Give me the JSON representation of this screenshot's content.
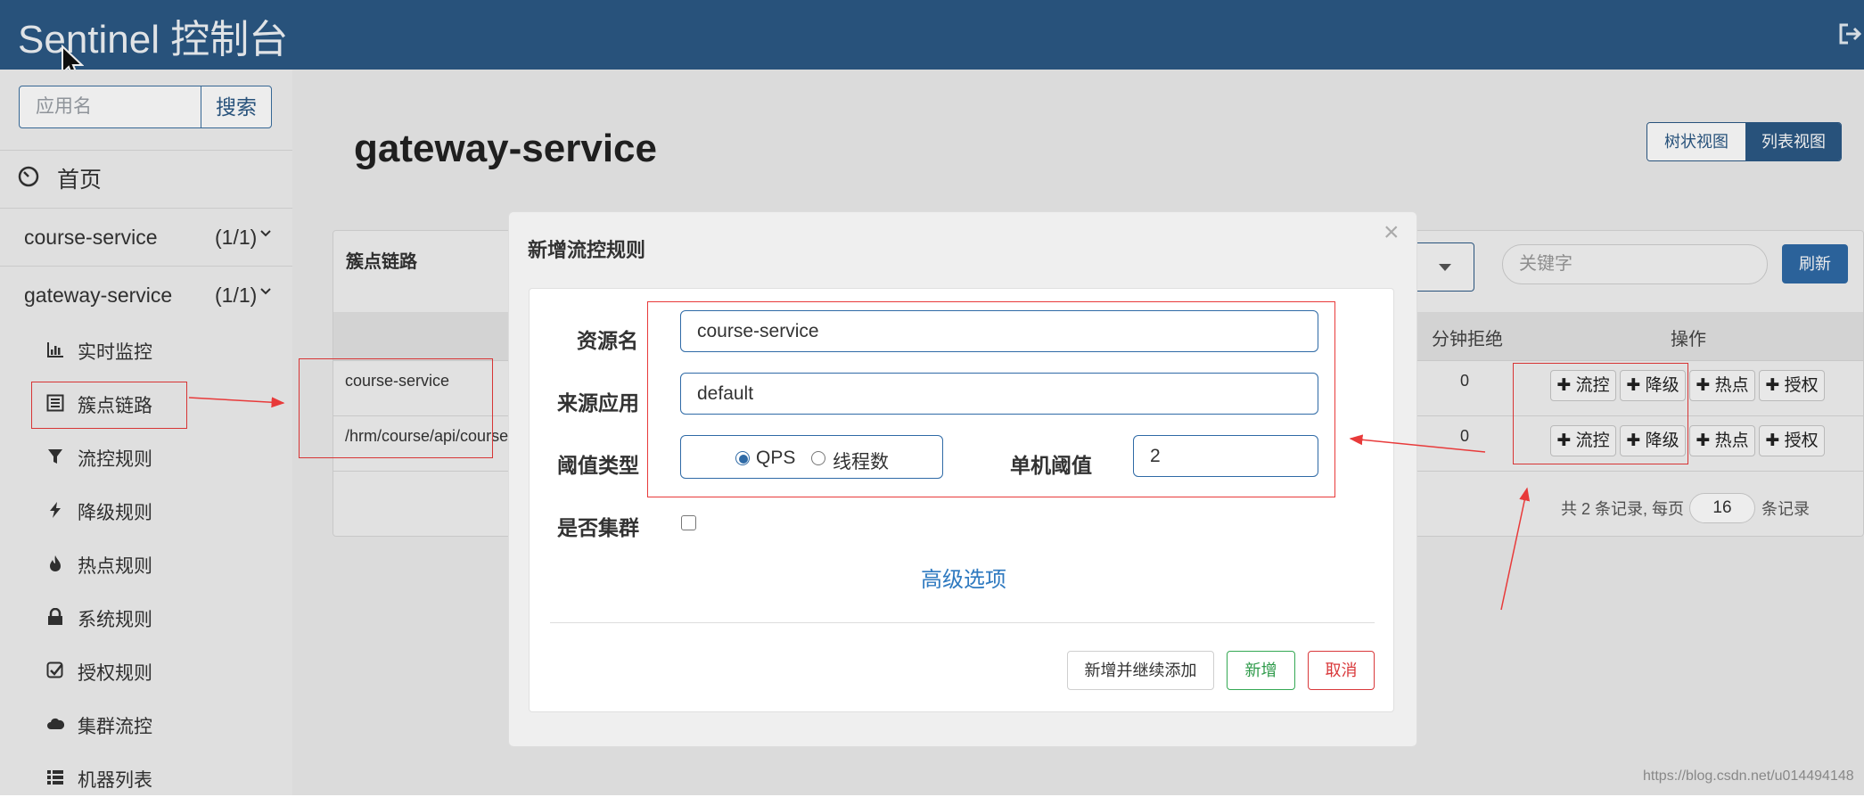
{
  "app": {
    "title": "Sentinel 控制台"
  },
  "sidebar": {
    "search_placeholder": "应用名",
    "search_button": "搜索",
    "home": "首页",
    "services": [
      {
        "name": "course-service",
        "count": "(1/1)"
      },
      {
        "name": "gateway-service",
        "count": "(1/1)"
      }
    ],
    "menu": [
      {
        "label": "实时监控",
        "icon": "bar-chart-icon"
      },
      {
        "label": "簇点链路",
        "icon": "list-icon"
      },
      {
        "label": "流控规则",
        "icon": "filter-icon"
      },
      {
        "label": "降级规则",
        "icon": "flash-icon"
      },
      {
        "label": "热点规则",
        "icon": "fire-icon"
      },
      {
        "label": "系统规则",
        "icon": "lock-icon"
      },
      {
        "label": "授权规则",
        "icon": "check-icon"
      },
      {
        "label": "集群流控",
        "icon": "cloud-icon"
      },
      {
        "label": "机器列表",
        "icon": "th-list-icon"
      }
    ]
  },
  "main": {
    "title": "gateway-service",
    "view_tree": "树状视图",
    "view_list": "列表视图",
    "panel_heading": "簇点链路",
    "keyword_placeholder": "关键字",
    "refresh": "刷新",
    "columns": {
      "reject": "分钟拒绝",
      "actions": "操作"
    },
    "rows": [
      {
        "resource": "course-service",
        "reject": "0"
      },
      {
        "resource": "/hrm/course/api/course",
        "reject": "0"
      }
    ],
    "actions": [
      "✚ 流控",
      "✚ 降级",
      "✚ 热点",
      "✚ 授权"
    ],
    "pager": {
      "text": "共 2 条记录, 每页",
      "page_size": "16",
      "suffix": "条记录"
    }
  },
  "modal": {
    "title": "新增流控规则",
    "close": "×",
    "fields": {
      "resource_label": "资源名",
      "resource_value": "course-service",
      "origin_label": "来源应用",
      "origin_value": "default",
      "grade_label": "阈值类型",
      "grade_options": [
        "QPS",
        "线程数"
      ],
      "grade_selected": "QPS",
      "threshold_label": "单机阈值",
      "threshold_value": "2",
      "cluster_label": "是否集群",
      "cluster_checked": false
    },
    "advanced": "高级选项",
    "buttons": {
      "save_continue": "新增并继续添加",
      "add": "新增",
      "cancel": "取消"
    }
  },
  "watermark": "https://blog.csdn.net/u014494148",
  "colors": {
    "topbar": "#2c5985",
    "primary": "#2f6aa6",
    "annotation": "#e83a3a",
    "success": "#34a853",
    "danger": "#d9383a"
  }
}
